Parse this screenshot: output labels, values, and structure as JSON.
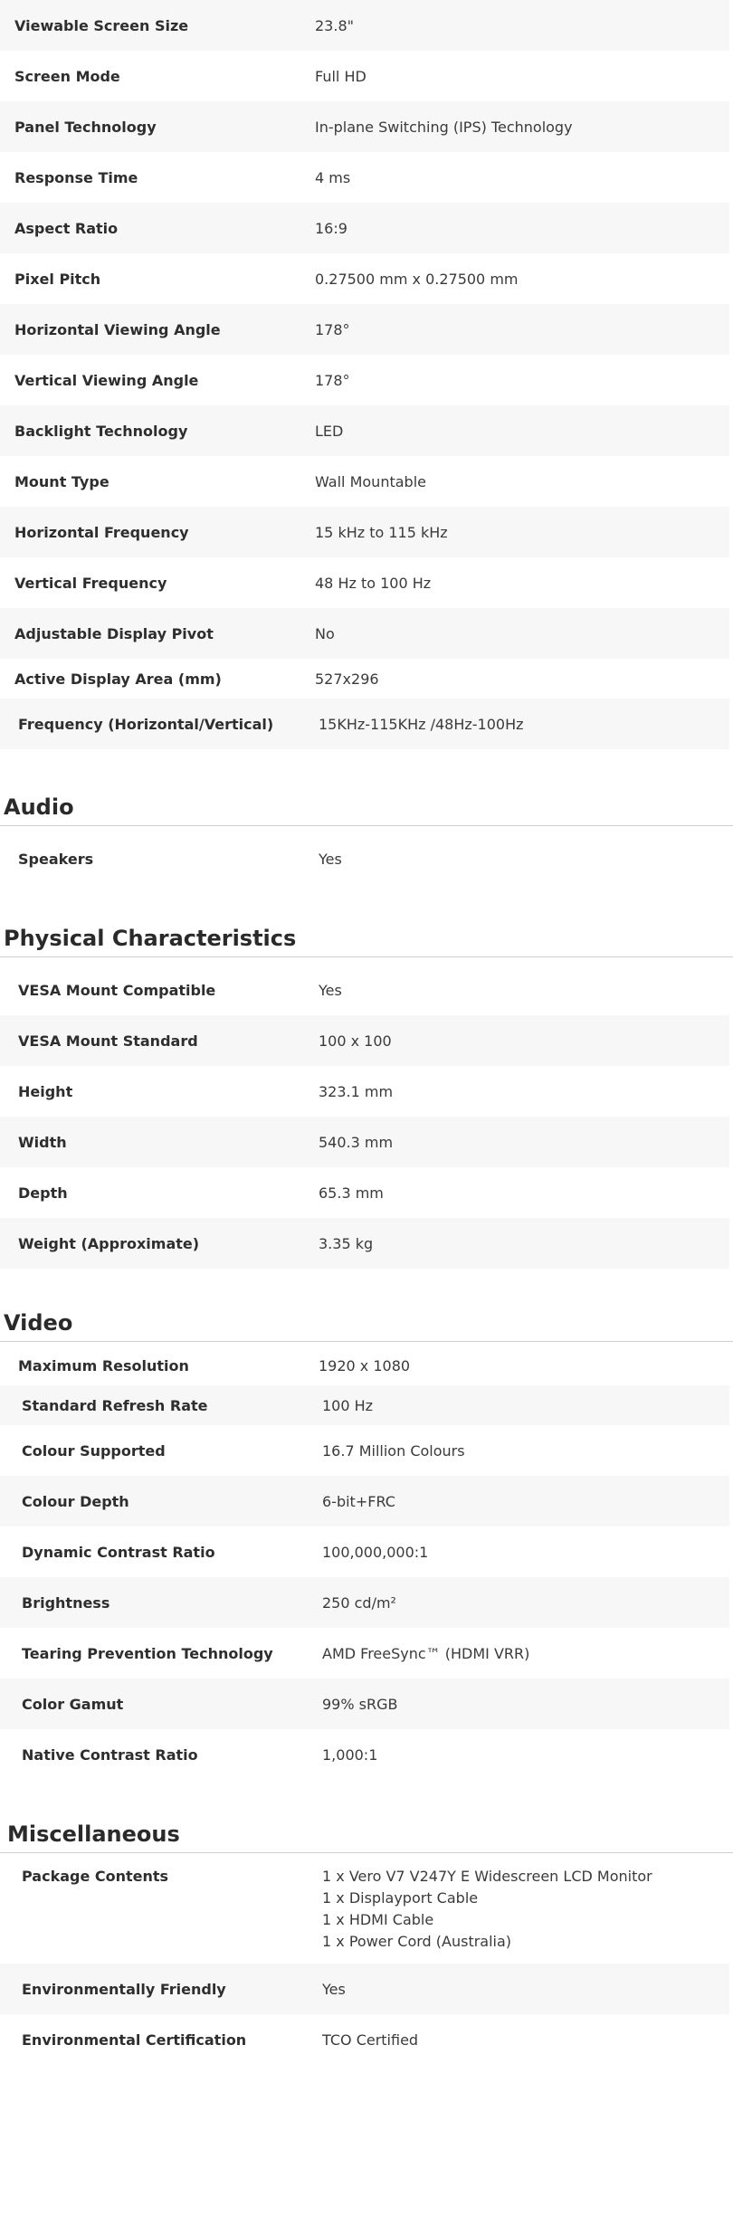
{
  "display": [
    {
      "label": "Viewable Screen Size",
      "value": "23.8\""
    },
    {
      "label": "Screen Mode",
      "value": "Full HD"
    },
    {
      "label": "Panel Technology",
      "value": "In-plane Switching (IPS) Technology"
    },
    {
      "label": "Response Time",
      "value": "4 ms"
    },
    {
      "label": "Aspect Ratio",
      "value": "16:9"
    },
    {
      "label": "Pixel Pitch",
      "value": "0.27500 mm x 0.27500 mm"
    },
    {
      "label": "Horizontal Viewing Angle",
      "value": "178°"
    },
    {
      "label": "Vertical Viewing Angle",
      "value": "178°"
    },
    {
      "label": "Backlight Technology",
      "value": "LED"
    },
    {
      "label": "Mount Type",
      "value": "Wall Mountable"
    },
    {
      "label": "Horizontal Frequency",
      "value": "15 kHz to 115 kHz"
    },
    {
      "label": "Vertical Frequency",
      "value": "48 Hz to 100 Hz"
    },
    {
      "label": "Adjustable Display Pivot",
      "value": "No"
    },
    {
      "label": "Active Display Area (mm)",
      "value": "527x296"
    },
    {
      "label": "Frequency (Horizontal/Vertical)",
      "value": "15KHz-115KHz /48Hz-100Hz"
    }
  ],
  "audio": {
    "title": "Audio",
    "rows": [
      {
        "label": "Speakers",
        "value": "Yes"
      }
    ]
  },
  "physical": {
    "title": "Physical Characteristics",
    "rows": [
      {
        "label": "VESA Mount Compatible",
        "value": "Yes"
      },
      {
        "label": "VESA Mount Standard",
        "value": "100 x 100"
      },
      {
        "label": "Height",
        "value": "323.1 mm"
      },
      {
        "label": "Width",
        "value": "540.3 mm"
      },
      {
        "label": "Depth",
        "value": "65.3 mm"
      },
      {
        "label": "Weight (Approximate)",
        "value": "3.35 kg"
      }
    ]
  },
  "video": {
    "title": "Video",
    "rows": [
      {
        "label": "Maximum Resolution",
        "value": "1920 x 1080"
      },
      {
        "label": "Standard Refresh Rate",
        "value": "100 Hz"
      },
      {
        "label": "Colour Supported",
        "value": "16.7 Million Colours"
      },
      {
        "label": "Colour Depth",
        "value": "6-bit+FRC"
      },
      {
        "label": "Dynamic Contrast Ratio",
        "value": "100,000,000:1"
      },
      {
        "label": "Brightness",
        "value": "250 cd/m²"
      },
      {
        "label": "Tearing Prevention Technology",
        "value": "AMD FreeSync™ (HDMI VRR)"
      },
      {
        "label": "Color Gamut",
        "value": "99% sRGB"
      },
      {
        "label": "Native Contrast Ratio",
        "value": "1,000:1"
      }
    ]
  },
  "misc": {
    "title": "Miscellaneous",
    "package_label": "Package Contents",
    "package_items": [
      "1 x Vero V7 V247Y E Widescreen LCD Monitor",
      "1 x Displayport Cable",
      "1 x HDMI Cable",
      "1 x Power Cord (Australia)"
    ],
    "rows": [
      {
        "label": "Environmentally Friendly",
        "value": "Yes"
      },
      {
        "label": "Environmental Certification",
        "value": "TCO Certified"
      }
    ]
  }
}
